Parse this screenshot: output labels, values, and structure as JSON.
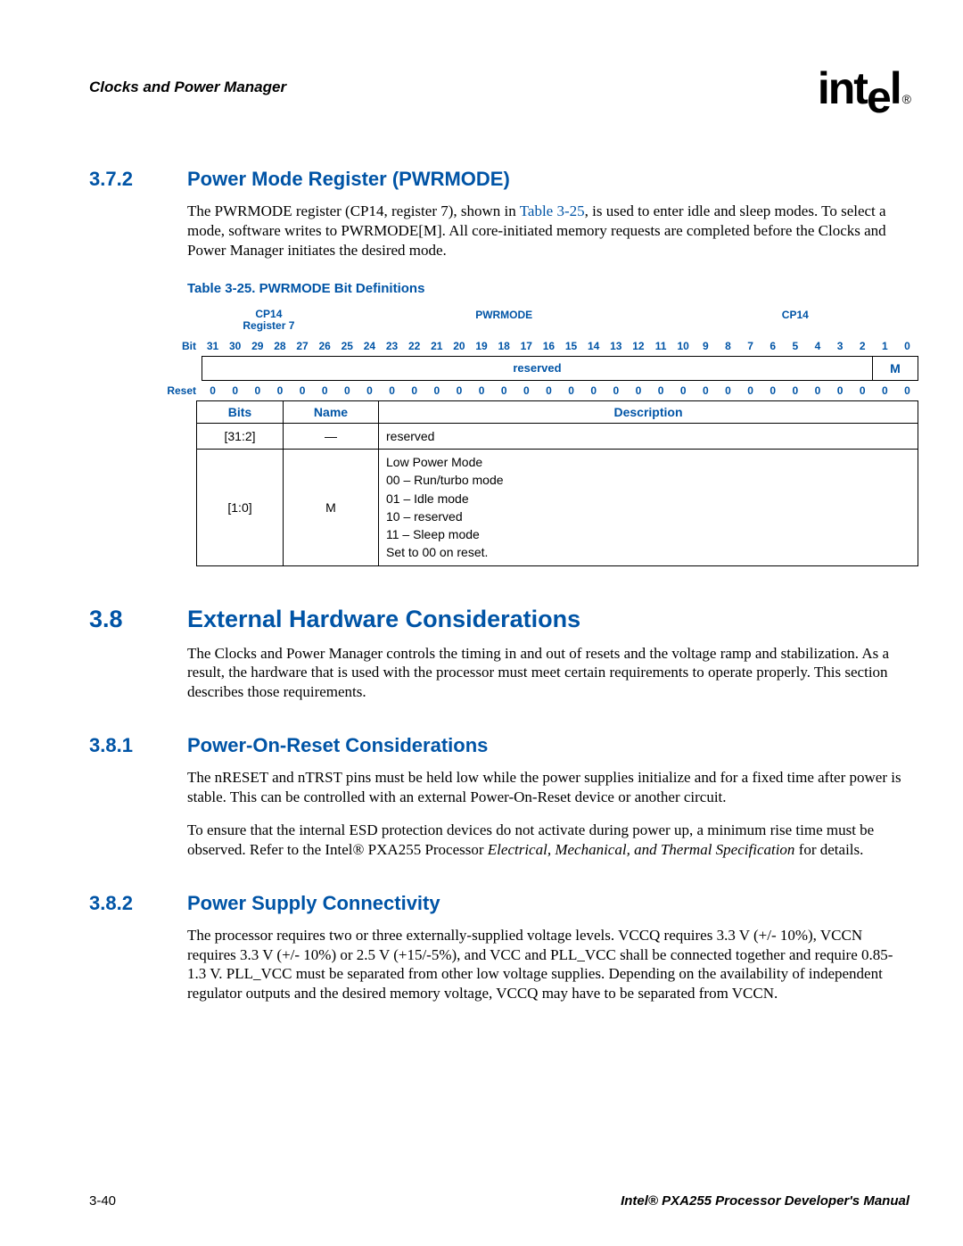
{
  "header": {
    "section": "Clocks and Power Manager",
    "logo": "intel",
    "reg": "®"
  },
  "s372": {
    "num": "3.7.2",
    "title": "Power Mode Register (PWRMODE)",
    "p1a": "The PWRMODE register (CP14, register 7), shown in ",
    "p1link": "Table 3-25",
    "p1b": ", is used to enter idle and sleep modes. To select a mode, software writes to PWRMODE[M]. All core-initiated memory requests are completed before the Clocks and Power Manager initiates the desired mode."
  },
  "table325": {
    "caption": "Table 3-25. PWRMODE Bit Definitions",
    "top_left_l1": "CP14",
    "top_left_l2": "Register 7",
    "top_mid": "PWRMODE",
    "top_right": "CP14",
    "row_bit_label": "Bit",
    "bits": [
      "31",
      "30",
      "29",
      "28",
      "27",
      "26",
      "25",
      "24",
      "23",
      "22",
      "21",
      "20",
      "19",
      "18",
      "17",
      "16",
      "15",
      "14",
      "13",
      "12",
      "11",
      "10",
      "9",
      "8",
      "7",
      "6",
      "5",
      "4",
      "3",
      "2",
      "1",
      "0"
    ],
    "field_reserved": "reserved",
    "field_m": "M",
    "row_reset_label": "Reset",
    "resets": [
      "0",
      "0",
      "0",
      "0",
      "0",
      "0",
      "0",
      "0",
      "0",
      "0",
      "0",
      "0",
      "0",
      "0",
      "0",
      "0",
      "0",
      "0",
      "0",
      "0",
      "0",
      "0",
      "0",
      "0",
      "0",
      "0",
      "0",
      "0",
      "0",
      "0",
      "0",
      "0"
    ],
    "hdr_bits": "Bits",
    "hdr_name": "Name",
    "hdr_desc": "Description",
    "rows": [
      {
        "bits": "[31:2]",
        "name": "—",
        "desc": "reserved"
      },
      {
        "bits": "[1:0]",
        "name": "M",
        "desc": "Low Power Mode\n00 – Run/turbo mode\n01 – Idle mode\n10 – reserved\n11 – Sleep mode\nSet to 00 on reset."
      }
    ]
  },
  "s38": {
    "num": "3.8",
    "title": "External Hardware Considerations",
    "p1": "The Clocks and Power Manager controls the timing in and out of resets and the voltage ramp and stabilization. As a result, the hardware that is used with the processor must meet certain requirements to operate properly. This section describes those requirements."
  },
  "s381": {
    "num": "3.8.1",
    "title": "Power-On-Reset Considerations",
    "p1": "The nRESET and nTRST pins must be held low while the power supplies initialize and for a fixed time after power is stable. This can be controlled with an external Power-On-Reset device or another circuit.",
    "p2a": "To ensure that the internal ESD protection devices do not activate during power up, a minimum rise time must be observed. Refer to the Intel® PXA255 Processor ",
    "p2i": "Electrical, Mechanical, and Thermal Specification",
    "p2b": " for details."
  },
  "s382": {
    "num": "3.8.2",
    "title": "Power Supply Connectivity",
    "p1": "The processor requires two or three externally-supplied voltage levels. VCCQ requires 3.3 V (+/- 10%), VCCN requires 3.3 V (+/- 10%) or 2.5 V (+15/-5%), and VCC and PLL_VCC shall be connected together and require 0.85-1.3 V. PLL_VCC must be separated from other low voltage supplies. Depending on the availability of independent regulator outputs and the desired memory voltage, VCCQ may have to be separated from VCCN."
  },
  "footer": {
    "left": "3-40",
    "right": "Intel® PXA255 Processor Developer's Manual"
  },
  "chart_data": {
    "type": "table",
    "title": "Table 3-25. PWRMODE Bit Definitions",
    "register": "CP14 Register 7 (PWRMODE)",
    "bit_numbers": [
      31,
      30,
      29,
      28,
      27,
      26,
      25,
      24,
      23,
      22,
      21,
      20,
      19,
      18,
      17,
      16,
      15,
      14,
      13,
      12,
      11,
      10,
      9,
      8,
      7,
      6,
      5,
      4,
      3,
      2,
      1,
      0
    ],
    "fields": [
      {
        "bits": "31:2",
        "name": "reserved",
        "reset": 0
      },
      {
        "bits": "1:0",
        "name": "M",
        "reset": 0
      }
    ],
    "reset_values": [
      0,
      0,
      0,
      0,
      0,
      0,
      0,
      0,
      0,
      0,
      0,
      0,
      0,
      0,
      0,
      0,
      0,
      0,
      0,
      0,
      0,
      0,
      0,
      0,
      0,
      0,
      0,
      0,
      0,
      0,
      0,
      0
    ],
    "descriptions": [
      {
        "bits": "[31:2]",
        "name": "—",
        "description": "reserved"
      },
      {
        "bits": "[1:0]",
        "name": "M",
        "description": "Low Power Mode: 00 Run/turbo mode, 01 Idle mode, 10 reserved, 11 Sleep mode. Set to 00 on reset."
      }
    ]
  }
}
